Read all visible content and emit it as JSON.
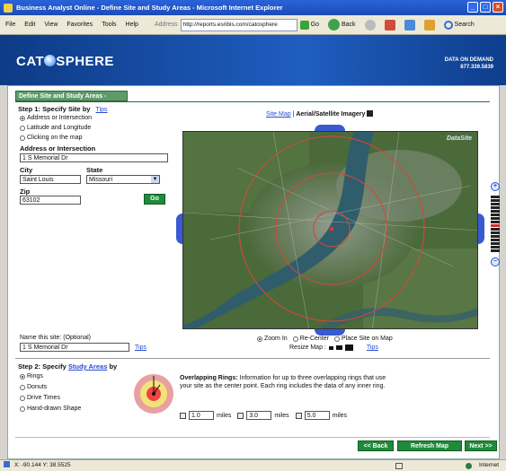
{
  "window": {
    "title": "Business Analyst Online - Define Site and Study Areas - Microsoft Internet Explorer",
    "menus": [
      "File",
      "Edit",
      "View",
      "Favorites",
      "Tools",
      "Help"
    ],
    "address_label": "Address",
    "address_value": "http://reports.esribis.com/catosphere",
    "go_label": "Go",
    "back_label": "Back",
    "search_label": "Search"
  },
  "header": {
    "logo_left": "CAT",
    "logo_right": "SPHERE",
    "right_line1": "DATA ON DEMAND",
    "right_line2": "877.339.5839"
  },
  "section_title": "Define Site and Study Areas -",
  "step1": {
    "title": "Step 1: Specify Site by",
    "tips": "Tips",
    "options": [
      "Address or Intersection",
      "Latitude and Longitude",
      "Clicking on the map"
    ],
    "selected_option": 0,
    "address_label": "Address or Intersection",
    "address_value": "1 S Memorial Dr",
    "city_label": "City",
    "city_value": "Saint Louis",
    "state_label": "State",
    "state_value": "Missouri",
    "zip_label": "Zip",
    "zip_value": "63102",
    "go_label": "Go"
  },
  "map": {
    "view_site_map": "Site Map",
    "separator": "|",
    "view_aerial": "Aerial/Satellite Imagery",
    "options": [
      "Zoom In",
      "Re-Center",
      "Place Site on Map"
    ],
    "selected_option": 0,
    "resize_label": "Resize Map :",
    "tips": "Tips",
    "brand_watermark": "DataSite"
  },
  "site_name": {
    "label": "Name this site: (Optional)",
    "value": "1 S Memorial Dr",
    "tips": "Tips"
  },
  "step2": {
    "title_prefix": "Step 2: Specify",
    "title_link": "Study Areas",
    "title_suffix": "by",
    "options": [
      "Rings",
      "Donuts",
      "Drive Times",
      "Hand-drawn Shape"
    ],
    "selected_option": 0,
    "rings_heading": "Overlapping Rings:",
    "rings_text": "Information for up to three overlapping rings that use your site as the center point. Each ring includes the data of any inner ring.",
    "rings": [
      {
        "value": "1.0",
        "unit": "miles"
      },
      {
        "value": "3.0",
        "unit": "miles"
      },
      {
        "value": "5.0",
        "unit": "miles"
      }
    ]
  },
  "footer": {
    "back": "<< Back",
    "refresh": "Refresh Map",
    "next": "Next >>"
  },
  "status": {
    "coords": "X: -90.144 Y: 38.5525",
    "zone": "Internet"
  },
  "colors": {
    "brand_blue": "#1f5dbf",
    "button_green": "#1f8b3a",
    "ring_red": "#d0493a"
  }
}
